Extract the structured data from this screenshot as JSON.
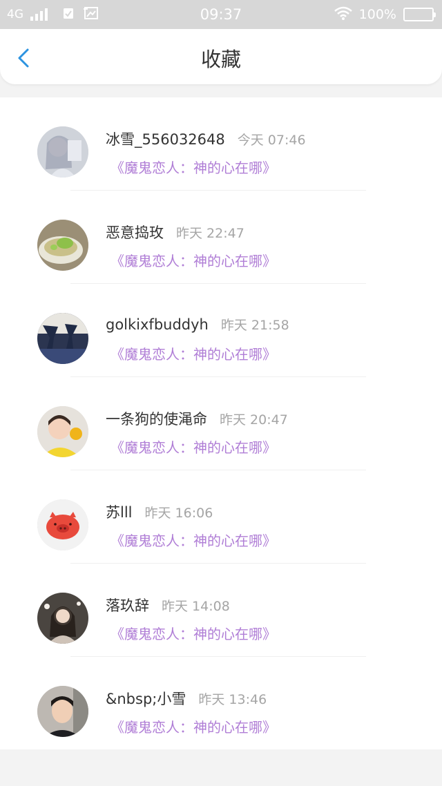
{
  "status_bar": {
    "network": "4G",
    "time": "09:37",
    "battery": "100%"
  },
  "header": {
    "title": "收藏"
  },
  "colors": {
    "accent_blue": "#2c93e0",
    "title_purple": "#b07ed6",
    "timestamp_gray": "#a5a5a5"
  },
  "items": [
    {
      "username": "冰雪_556032648",
      "time": "今天 07:46",
      "title": "《魔鬼恋人：神的心在哪》",
      "avatar_icon": "anime-girl-avatar"
    },
    {
      "username": "恶意捣玫",
      "time": "昨天 22:47",
      "title": "《魔鬼恋人：神的心在哪》",
      "avatar_icon": "soup-bowl-avatar"
    },
    {
      "username": "golkixfbuddyh",
      "time": "昨天 21:58",
      "title": "《魔鬼恋人：神的心在哪》",
      "avatar_icon": "dancers-avatar"
    },
    {
      "username": "一条狗的使渑命",
      "time": "昨天 20:47",
      "title": "《魔鬼恋人：神的心在哪》",
      "avatar_icon": "child-with-flower-avatar"
    },
    {
      "username": "苏lll",
      "time": "昨天 16:06",
      "title": "《魔鬼恋人：神的心在哪》",
      "avatar_icon": "pig-face-avatar"
    },
    {
      "username": "落玖辞",
      "time": "昨天 14:08",
      "title": "《魔鬼恋人：神的心在哪》",
      "avatar_icon": "ancient-style-girl-avatar"
    },
    {
      "username": "&nbsp;小雪",
      "time": "昨天 13:46",
      "title": "《魔鬼恋人：神的心在哪》",
      "avatar_icon": "boy-portrait-avatar"
    }
  ]
}
